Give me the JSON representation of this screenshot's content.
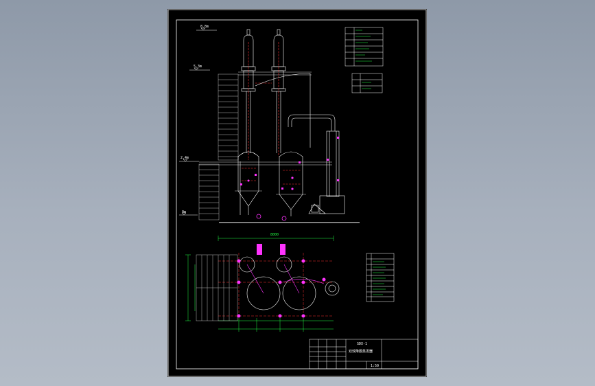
{
  "elevations": {
    "top": "8.8m",
    "mid": "5.3m",
    "platform": "2.4m",
    "ground": "0m"
  },
  "plan_dimension": "8000",
  "title_block": {
    "drawing_no": "SDX-1",
    "title": "双效降膜蒸发器",
    "scale": "1:50"
  },
  "colors": {
    "sheet": "#000000",
    "border": "#ffffff",
    "equipment": "#ffffff",
    "pipe_red": "#ff3333",
    "pipe_magenta": "#ff33ff",
    "dimension": "#22ff44",
    "frame": "#2a2a2a"
  }
}
